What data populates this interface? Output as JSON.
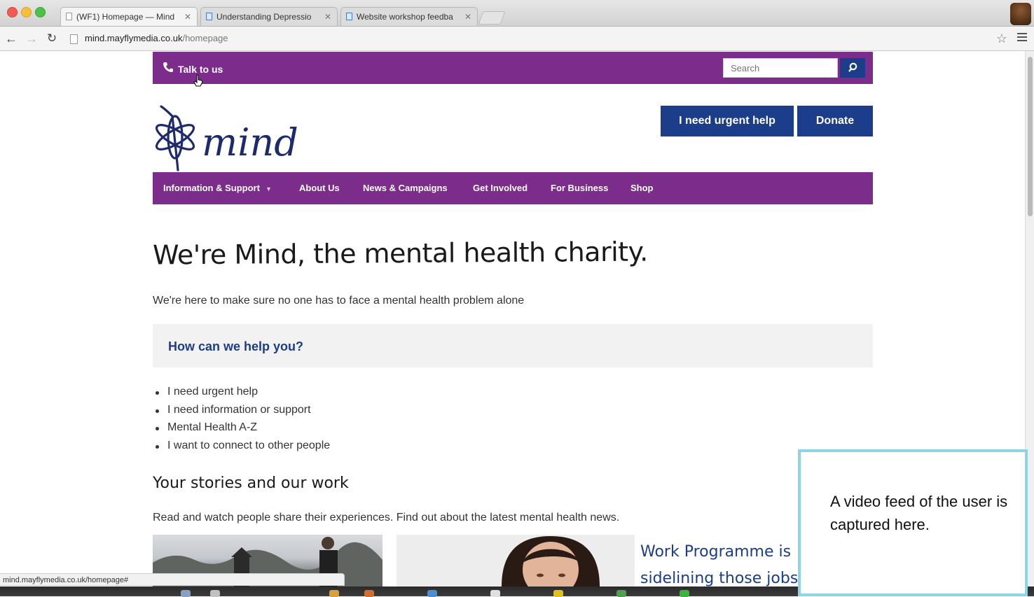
{
  "browser": {
    "tabs": [
      {
        "title": "(WF1) Homepage — Mind",
        "active": true
      },
      {
        "title": "Understanding Depressio",
        "active": false
      },
      {
        "title": "Website workshop feedba",
        "active": false
      }
    ],
    "url_host": "mind.mayflymedia.co.uk",
    "url_path": "/homepage",
    "status_url": "mind.mayflymedia.co.uk/homepage#"
  },
  "site": {
    "topbar": {
      "talk_label": "Talk to us",
      "search_placeholder": "Search"
    },
    "brand": "mind",
    "actions": {
      "urgent_label": "I need urgent help",
      "donate_label": "Donate"
    },
    "nav": [
      {
        "label": "Information & Support",
        "has_dropdown": true
      },
      {
        "label": "About Us"
      },
      {
        "label": "News & Campaigns"
      },
      {
        "label": "Get Involved"
      },
      {
        "label": "For Business"
      },
      {
        "label": "Shop"
      }
    ],
    "hero": {
      "title": "We're Mind, the mental health charity.",
      "subtitle": "We're here to make sure no one has to face a mental health problem alone"
    },
    "help": {
      "title": "How can we help you?",
      "links": [
        "I need urgent help",
        "I need information or support",
        "Mental Health A-Z",
        "I want to connect to other people"
      ]
    },
    "stories": {
      "title": "Your stories and our work",
      "subtitle": "Read and watch people share their experiences. Find out about the latest mental health news."
    },
    "feature": {
      "title_line1": "Work Programme is",
      "title_line2": "sidelining those jobs"
    }
  },
  "overlay": {
    "video_text": "A video feed of the user is captured here."
  },
  "colors": {
    "brand_purple": "#7c2d8b",
    "brand_navy": "#1b3d8a",
    "help_bg": "#f2f2f2",
    "overlay_border": "#8fd4e4"
  }
}
